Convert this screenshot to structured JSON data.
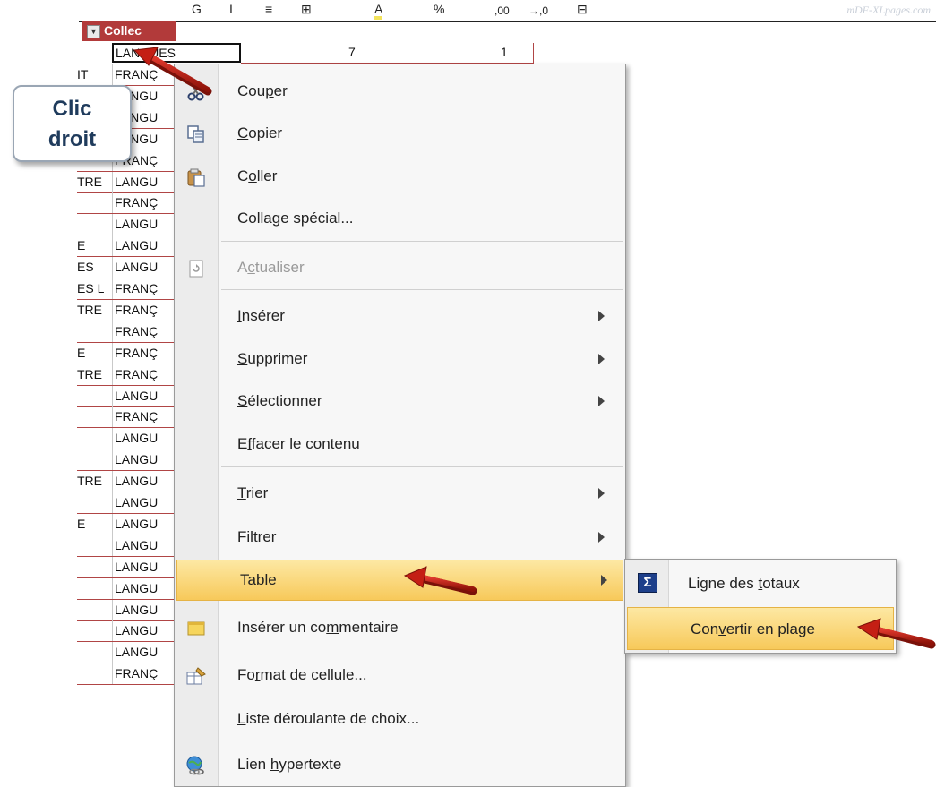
{
  "watermark": "mDF-XLpages.com",
  "toolbar": {
    "glyphs": [
      "G",
      "I",
      "≡",
      "⊞",
      "%",
      "A",
      ",00",
      "→,0",
      "⊟"
    ]
  },
  "column_header": {
    "label": "Collec"
  },
  "selected_row": {
    "value": "LANGUES",
    "number": "7",
    "count": "1"
  },
  "rows": [
    {
      "frag": "IT",
      "val": "FRANÇ"
    },
    {
      "frag": "",
      "val": "LANGU"
    },
    {
      "frag": "",
      "val": "LANGU"
    },
    {
      "frag": "",
      "val": "LANGU"
    },
    {
      "frag": "",
      "val": "FRANÇ"
    },
    {
      "frag": "TRE",
      "val": "LANGU"
    },
    {
      "frag": "",
      "val": "FRANÇ"
    },
    {
      "frag": "",
      "val": "LANGU"
    },
    {
      "frag": "E",
      "val": "LANGU"
    },
    {
      "frag": "ES",
      "val": "LANGU"
    },
    {
      "frag": "ES L",
      "val": "FRANÇ"
    },
    {
      "frag": "TRE",
      "val": "FRANÇ"
    },
    {
      "frag": "",
      "val": "FRANÇ"
    },
    {
      "frag": "E",
      "val": "FRANÇ"
    },
    {
      "frag": "TRE",
      "val": "FRANÇ"
    },
    {
      "frag": "",
      "val": "LANGU"
    },
    {
      "frag": "",
      "val": "FRANÇ"
    },
    {
      "frag": "",
      "val": "LANGU"
    },
    {
      "frag": "",
      "val": "LANGU"
    },
    {
      "frag": "TRE",
      "val": "LANGU"
    },
    {
      "frag": "",
      "val": "LANGU"
    },
    {
      "frag": "E",
      "val": "LANGU"
    },
    {
      "frag": "",
      "val": "LANGU"
    },
    {
      "frag": "",
      "val": "LANGU"
    },
    {
      "frag": "",
      "val": "LANGU"
    },
    {
      "frag": "",
      "val": "LANGU"
    },
    {
      "frag": "",
      "val": "LANGU"
    },
    {
      "frag": "",
      "val": "LANGU"
    },
    {
      "frag": "",
      "val": "FRANÇ"
    }
  ],
  "callout": {
    "line1": "Clic",
    "line2": "droit"
  },
  "menu": {
    "items": [
      {
        "pre": "Cou",
        "u": "p",
        "post": "er",
        "icon": "scissors-icon"
      },
      {
        "pre": "",
        "u": "C",
        "post": "opier",
        "icon": "copy-icon"
      },
      {
        "pre": "C",
        "u": "o",
        "post": "ller",
        "icon": "paste-icon"
      },
      {
        "pre": "Colla",
        "u": "g",
        "post": "e spécial...",
        "icon": ""
      },
      {
        "pre": "A",
        "u": "c",
        "post": "tualiser",
        "icon": "refresh-icon",
        "disabled": true
      },
      {
        "pre": "",
        "u": "I",
        "post": "nsérer",
        "icon": "",
        "arrow": true
      },
      {
        "pre": "",
        "u": "S",
        "post": "upprimer",
        "icon": "",
        "arrow": true
      },
      {
        "pre": "",
        "u": "S",
        "post": "électionner",
        "icon": "",
        "arrow": true
      },
      {
        "pre": "E",
        "u": "f",
        "post": "facer le contenu",
        "icon": ""
      },
      {
        "pre": "",
        "u": "T",
        "post": "rier",
        "icon": "",
        "arrow": true
      },
      {
        "pre": "Filt",
        "u": "r",
        "post": "er",
        "icon": "",
        "arrow": true
      },
      {
        "pre": "Ta",
        "u": "b",
        "post": "le",
        "icon": "",
        "arrow": true,
        "highlight": true
      },
      {
        "pre": "Insérer un co",
        "u": "m",
        "post": "mentaire",
        "icon": "comment-icon"
      },
      {
        "pre": "Fo",
        "u": "r",
        "post": "mat de cellule...",
        "icon": "format-cells-icon"
      },
      {
        "pre": "",
        "u": "L",
        "post": "iste déroulante de choix...",
        "icon": ""
      },
      {
        "pre": "Lien ",
        "u": "h",
        "post": "ypertexte",
        "icon": "hyperlink-icon"
      }
    ]
  },
  "submenu": {
    "items": [
      {
        "pre": "Ligne des ",
        "u": "t",
        "post": "otaux",
        "icon": "sigma-icon"
      },
      {
        "pre": "Con",
        "u": "v",
        "post": "ertir en plage",
        "icon": "",
        "highlight": true
      }
    ]
  }
}
